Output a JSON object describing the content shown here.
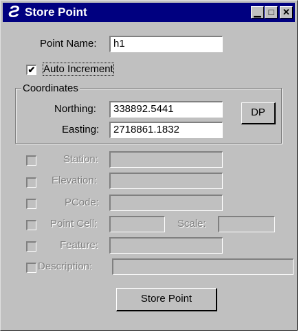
{
  "window": {
    "title": "Store Point",
    "icon_glyph": "Ƨ",
    "controls": {
      "minimize": "▁",
      "maximize": "□",
      "close": "✕"
    }
  },
  "form": {
    "point_name_label": "Point Name:",
    "point_name_value": "h1",
    "auto_increment_label": "Auto Increment",
    "auto_increment_checked": "✔",
    "coordinates_label": "Coordinates",
    "northing_label": "Northing:",
    "northing_value": "338892.5441",
    "easting_label": "Easting:",
    "easting_value": "2718861.1832",
    "dp_label": "DP",
    "station_label": "Station:",
    "elevation_label": "Elevation:",
    "pcode_label": "PCode:",
    "point_cell_label": "Point Cell:",
    "scale_label": "Scale:",
    "feature_label": "Feature:",
    "description_label": "Description:",
    "store_button_label": "Store Point"
  },
  "colors": {
    "title_bar": "#000080",
    "face": "#c0c0c0",
    "disabled_text": "#808080"
  }
}
